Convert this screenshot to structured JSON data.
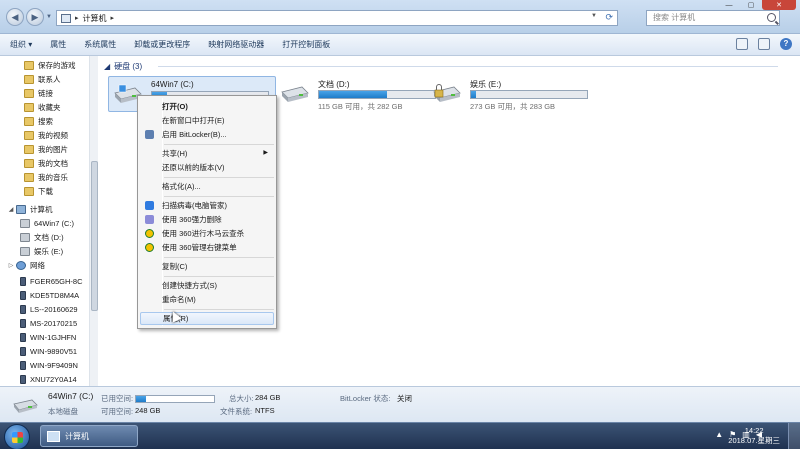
{
  "address": {
    "root_sep": "▸",
    "location": "计算机",
    "end_sep": "▸"
  },
  "search": {
    "placeholder": "搜索 计算机"
  },
  "toolbar": [
    "组织 ▾",
    "属性",
    "系统属性",
    "卸载或更改程序",
    "映射网络驱动器",
    "打开控制面板"
  ],
  "sidebar": [
    {
      "label": "保存的游戏",
      "type": "fold"
    },
    {
      "label": "联系人",
      "type": "fold"
    },
    {
      "label": "链接",
      "type": "fold"
    },
    {
      "label": "收藏夹",
      "type": "fold"
    },
    {
      "label": "搜索",
      "type": "fold"
    },
    {
      "label": "我的视频",
      "type": "fold"
    },
    {
      "label": "我的图片",
      "type": "fold"
    },
    {
      "label": "我的文档",
      "type": "fold"
    },
    {
      "label": "我的音乐",
      "type": "fold"
    },
    {
      "label": "下载",
      "type": "fold"
    },
    {
      "label": "计算机",
      "type": "pc"
    },
    {
      "label": "64Win7  (C:)",
      "type": "drv"
    },
    {
      "label": "文档 (D:)",
      "type": "drv"
    },
    {
      "label": "娱乐 (E:)",
      "type": "drv"
    },
    {
      "label": "网络",
      "type": "net"
    },
    {
      "label": "FGER65GH-8C",
      "type": "host"
    },
    {
      "label": "KDE5TD8M4A",
      "type": "host"
    },
    {
      "label": "LS--20160629",
      "type": "host"
    },
    {
      "label": "MS-20170215",
      "type": "host"
    },
    {
      "label": "WIN-1GJHFN",
      "type": "host"
    },
    {
      "label": "WIN-9890V51",
      "type": "host"
    },
    {
      "label": "WIN-9F9409N",
      "type": "host"
    },
    {
      "label": "XNU72Y0A14",
      "type": "host"
    }
  ],
  "group": {
    "title": "硬盘 (3)"
  },
  "drives": [
    {
      "name": "64Win7  (C:)",
      "space": "",
      "used_fraction": 0.13
    },
    {
      "name": "文档 (D:)",
      "space": "115 GB 可用，共 282 GB",
      "used_fraction": 0.59
    },
    {
      "name": "娱乐 (E:)",
      "space": "273 GB 可用，共 283 GB",
      "used_fraction": 0.04
    }
  ],
  "context_menu": [
    {
      "label": "打开(O)",
      "bold": true
    },
    {
      "label": "在新窗口中打开(E)"
    },
    {
      "label": "启用 BitLocker(B)...",
      "icon": "shield-icon"
    },
    {
      "sep": true
    },
    {
      "label": "共享(H)",
      "submenu": true
    },
    {
      "label": "还原以前的版本(V)"
    },
    {
      "sep": true
    },
    {
      "label": "格式化(A)..."
    },
    {
      "sep": true
    },
    {
      "label": "扫描病毒(电脑管家)",
      "icon": "shield-scan-icon"
    },
    {
      "label": "使用 360强力删除",
      "icon": "delete-360-icon"
    },
    {
      "label": "使用 360进行木马云查杀",
      "icon": "trojan-scan-icon"
    },
    {
      "label": "使用 360管理右键菜单",
      "icon": "menu-360-icon"
    },
    {
      "sep": true
    },
    {
      "label": "复制(C)"
    },
    {
      "sep": true
    },
    {
      "label": "创建快捷方式(S)"
    },
    {
      "label": "重命名(M)"
    },
    {
      "sep": true
    },
    {
      "label": "属性(R)",
      "hover": true
    }
  ],
  "details": {
    "name": "64Win7  (C:)",
    "type": "本地磁盘",
    "used_label": "已用空间:",
    "free_label": "可用空间:",
    "free_value": "248 GB",
    "total_label": "总大小:",
    "total_value": "284 GB",
    "fs_label": "文件系统:",
    "fs_value": "NTFS",
    "bitlocker_label": "BitLocker 状态:",
    "bitlocker_value": "关闭",
    "used_fraction": 0.13
  },
  "taskbar": {
    "item": "计算机",
    "time": "14:22",
    "date": "2018.07.星期三"
  }
}
